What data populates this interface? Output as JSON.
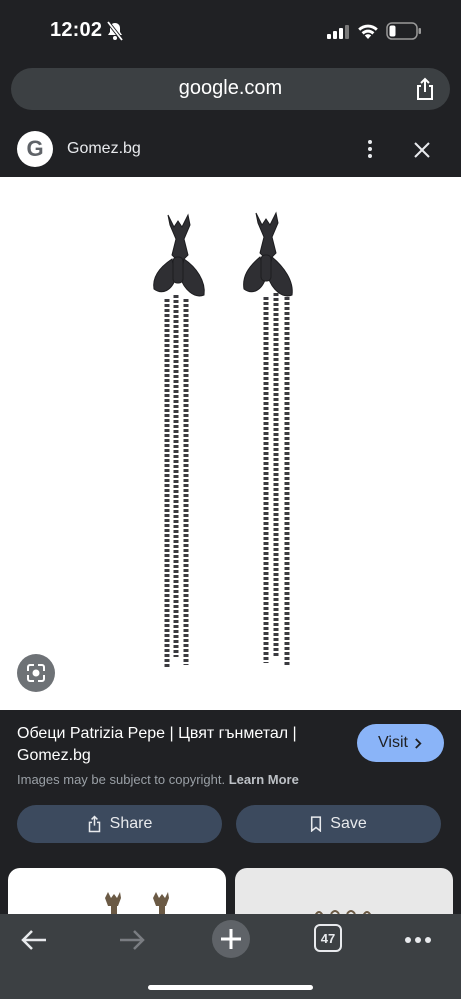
{
  "status_bar": {
    "time": "12:02"
  },
  "address_bar": {
    "url": "google.com"
  },
  "source": {
    "logo_letter": "G",
    "name": "Gomez.bg"
  },
  "result": {
    "title": "Обеци Patrizia Pepe | Цвят гънметал | Gomez.bg",
    "visit_label": "Visit",
    "copyright_text": "Images may be subject to copyright.",
    "learn_more": "Learn More",
    "share_label": "Share",
    "save_label": "Save"
  },
  "toolbar": {
    "tabs_count": "47"
  },
  "colors": {
    "accent": "#8ab4f8",
    "background": "#202124",
    "button_bg": "#3c4a5e"
  },
  "icons": [
    "bell-slash-icon",
    "signal-icon",
    "wifi-icon",
    "battery-icon",
    "share-icon",
    "more-vert-icon",
    "close-icon",
    "lens-icon",
    "chevron-right-icon",
    "bookmark-icon",
    "back-arrow-icon",
    "forward-arrow-icon",
    "plus-icon",
    "tabs-icon",
    "more-horiz-icon"
  ]
}
